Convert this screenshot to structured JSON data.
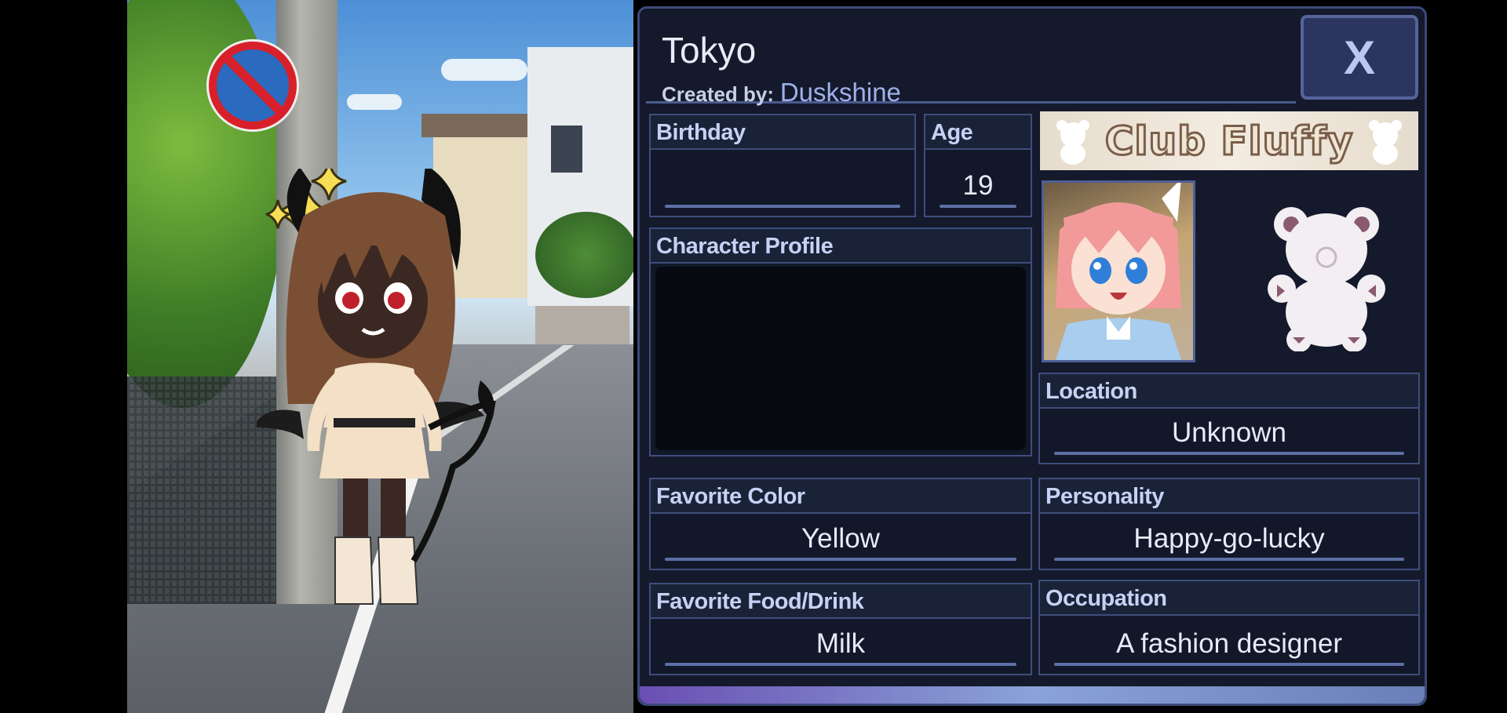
{
  "profile": {
    "name": "Tokyo",
    "created_by_label": "Created by:",
    "created_by": "Duskshine",
    "close_label": "X"
  },
  "fields": {
    "birthday": {
      "label": "Birthday",
      "value": ""
    },
    "age": {
      "label": "Age",
      "value": "19"
    },
    "character_profile": {
      "label": "Character Profile",
      "value": ""
    },
    "favorite_color": {
      "label": "Favorite Color",
      "value": "Yellow"
    },
    "favorite_food": {
      "label": "Favorite Food/Drink",
      "value": "Milk"
    },
    "location": {
      "label": "Location",
      "value": "Unknown"
    },
    "personality": {
      "label": "Personality",
      "value": "Happy-go-lucky"
    },
    "occupation": {
      "label": "Occupation",
      "value": "A fashion designer"
    }
  },
  "club": {
    "name": "Club Fluffy"
  },
  "icons": [
    "no-parking-sign",
    "sparkle-icon",
    "bear-icon",
    "close-icon"
  ],
  "colors": {
    "panel": "#141a2c",
    "accent": "#3f4d7c",
    "text": "#e7ebf8"
  }
}
